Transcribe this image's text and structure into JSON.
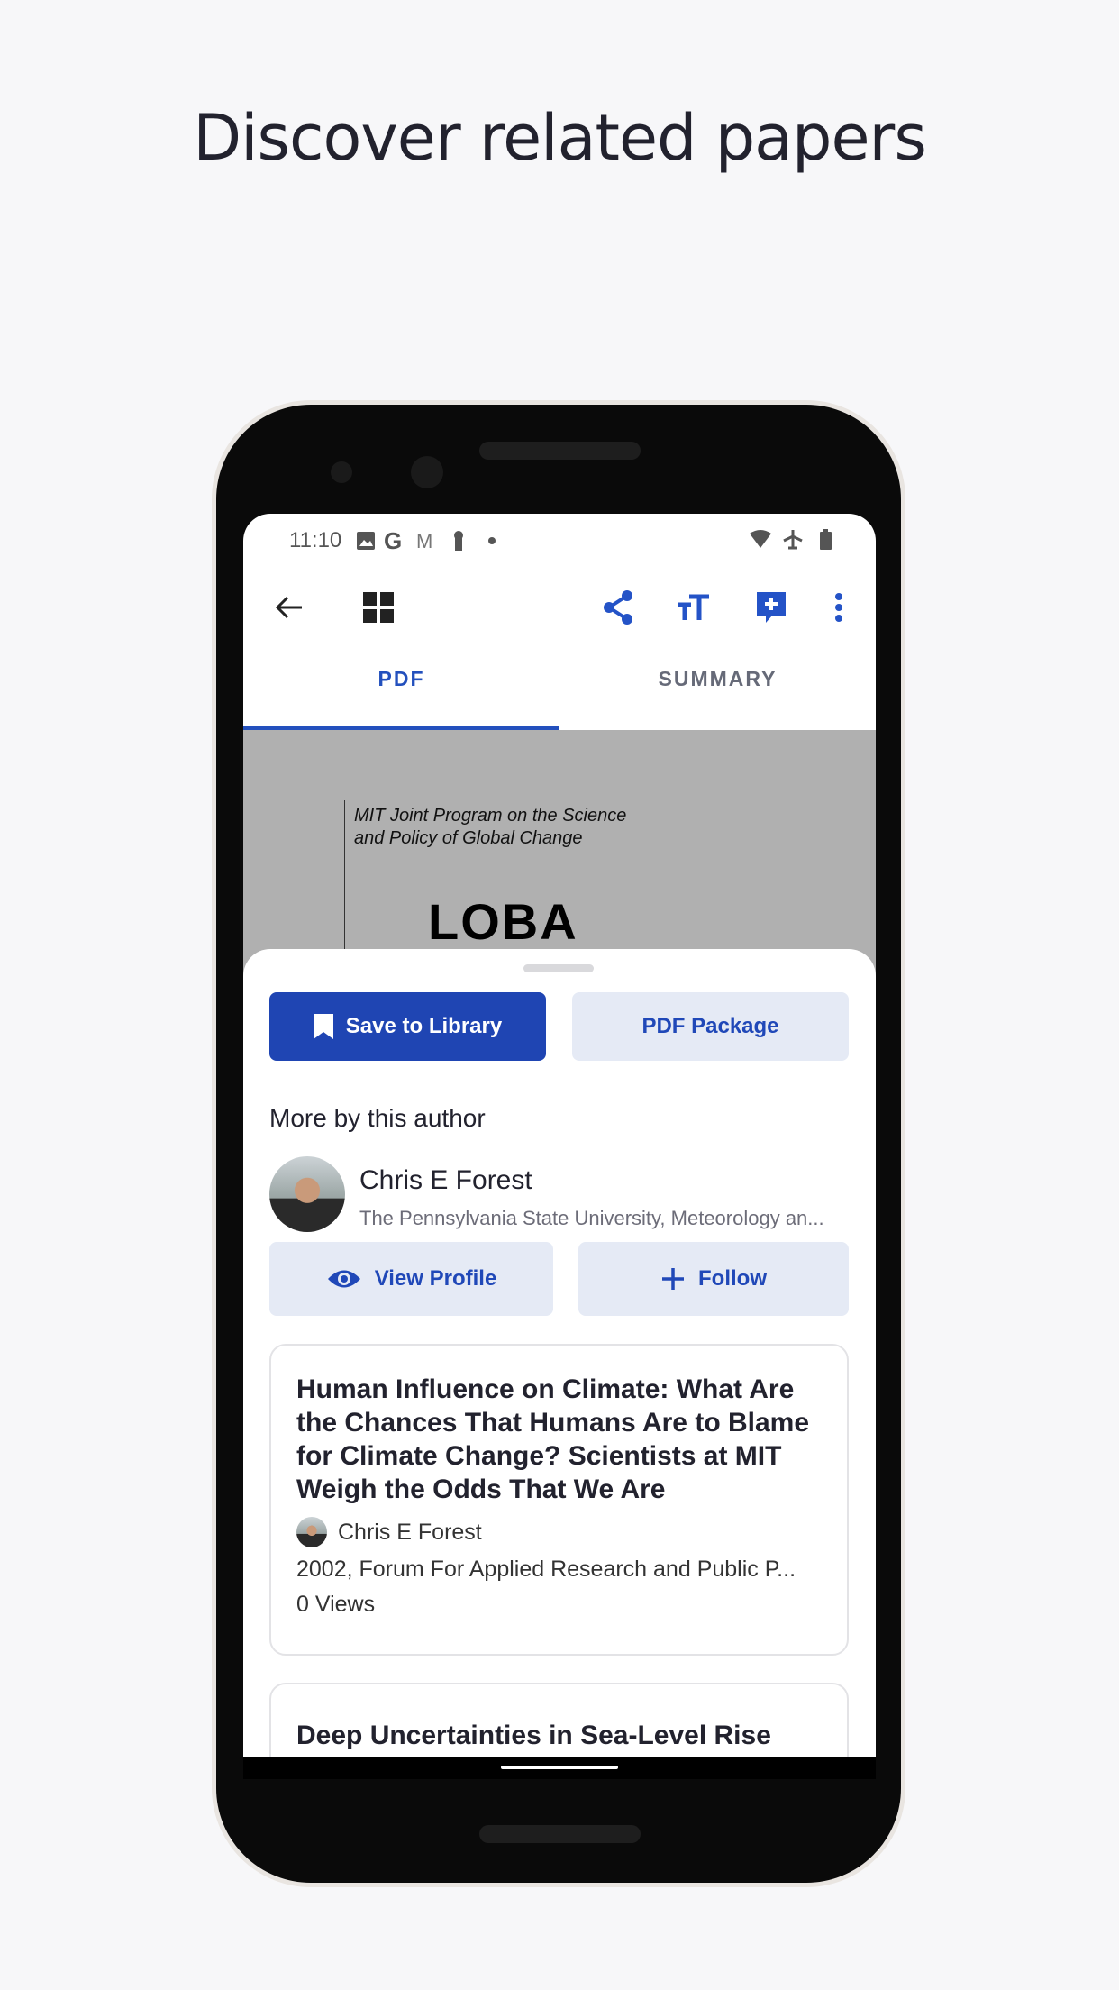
{
  "headline": "Discover related papers",
  "status_bar": {
    "time": "11:10",
    "icons": [
      "image-icon",
      "google-icon",
      "gmail-icon",
      "keyhole-icon",
      "dot-icon",
      "wifi-icon",
      "airplane-icon",
      "battery-icon"
    ]
  },
  "toolbar": {
    "icons": [
      "back-arrow-icon",
      "grid-icon",
      "share-icon",
      "text-size-icon",
      "add-comment-icon",
      "more-vert-icon"
    ]
  },
  "tabs": [
    {
      "label": "PDF",
      "active": true
    },
    {
      "label": "SUMMARY",
      "active": false
    }
  ],
  "pdf_preview": {
    "line1": "MIT Joint Program on the Science",
    "line2": "and Policy of Global Change",
    "logo_text": "LOBA"
  },
  "sheet": {
    "save_label": "Save to Library",
    "package_label": "PDF Package",
    "section_title": "More by this author",
    "author": {
      "name": "Chris E Forest",
      "affiliation": "The Pennsylvania State University, Meteorology an..."
    },
    "view_profile_label": "View Profile",
    "follow_label": "Follow",
    "papers": [
      {
        "title": "Human Influence on Climate: What Are the Chances That Humans Are to Blame for Climate Change? Scientists at MIT Weigh the Odds That We Are",
        "author": "Chris E Forest",
        "venue": "2002, Forum For Applied Research and Public P...",
        "views": "0 Views"
      },
      {
        "title": "Deep Uncertainties in Sea-Level Rise and Storm Surge Projections"
      }
    ]
  },
  "colors": {
    "accent": "#1f45b3",
    "button_light": "#e5eaf5",
    "text": "#22222e"
  }
}
